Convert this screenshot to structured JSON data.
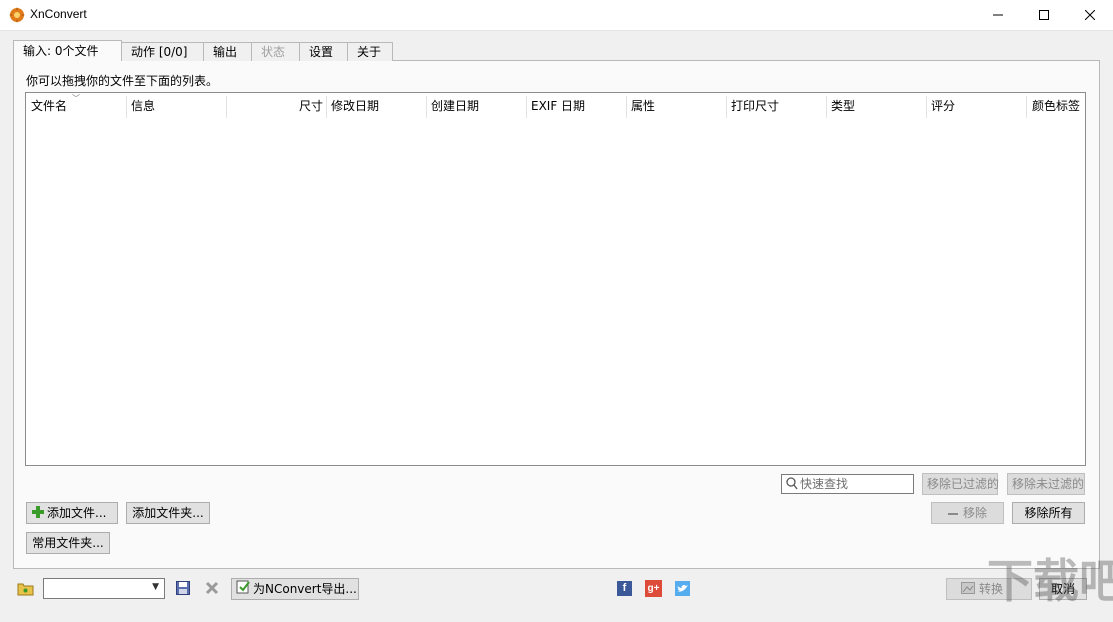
{
  "window": {
    "title": "XnConvert",
    "minimize_icon": "minimize-icon",
    "maximize_icon": "maximize-icon",
    "close_icon": "close-icon"
  },
  "tabs": [
    {
      "label": "输入: 0个文件",
      "state": "active"
    },
    {
      "label": "动作 [0/0]",
      "state": "normal"
    },
    {
      "label": "输出",
      "state": "normal"
    },
    {
      "label": "状态",
      "state": "disabled"
    },
    {
      "label": "设置",
      "state": "normal"
    },
    {
      "label": "关于",
      "state": "normal"
    }
  ],
  "input": {
    "hint": "你可以拖拽你的文件至下面的列表。",
    "columns": [
      "文件名",
      "信息",
      "尺寸",
      "修改日期",
      "创建日期",
      "EXIF 日期",
      "属性",
      "打印尺寸",
      "类型",
      "评分",
      "颜色标签"
    ],
    "search_placeholder": "快速查找",
    "buttons": {
      "add_files": "添加文件...",
      "add_folder": "添加文件夹...",
      "favorite_folders": "常用文件夹...",
      "remove_filtered": "移除已过滤的",
      "remove_unfiltered": "移除未过滤的",
      "remove": "移除",
      "remove_all": "移除所有"
    }
  },
  "bottom": {
    "preset_value": "",
    "export_button": "为NConvert导出...",
    "convert_button": "转换",
    "cancel_button": "取消"
  },
  "colors": {
    "accent_green": "#3a9a2a",
    "facebook": "#3b5998",
    "google_plus": "#dd4b39",
    "twitter": "#55acee"
  },
  "watermark": "下载吧"
}
